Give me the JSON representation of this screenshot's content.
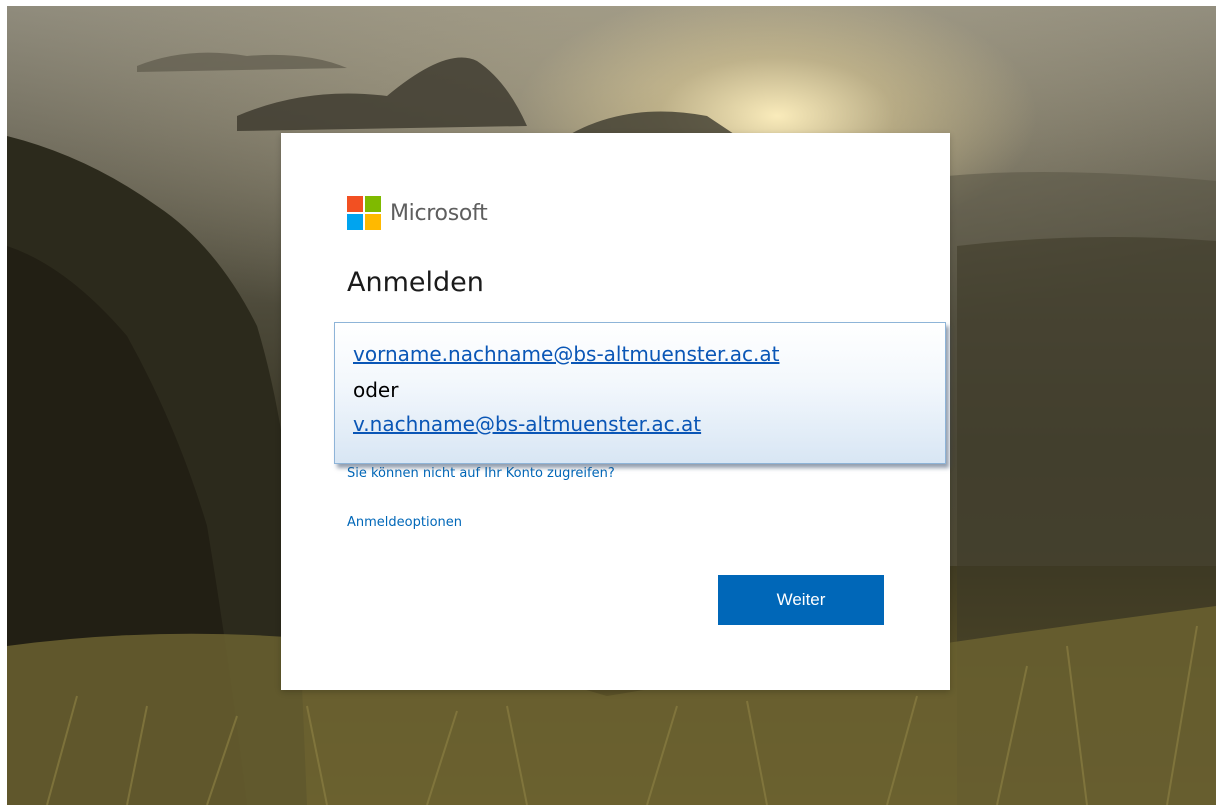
{
  "brand": {
    "name": "Microsoft",
    "logo_colors": [
      "#f25022",
      "#7fba00",
      "#00a4ef",
      "#ffb900"
    ]
  },
  "signin": {
    "title": "Anmelden",
    "hint": {
      "email_full": "vorname.nachname@bs-altmuenster.ac.at",
      "separator": "oder",
      "email_short": "v.nachname@bs-altmuenster.ac.at"
    },
    "cant_access_link": "Sie können nicht auf Ihr Konto zugreifen?",
    "options_link": "Anmeldeoptionen",
    "next_button": "Weiter"
  },
  "colors": {
    "accent": "#0067b8"
  }
}
